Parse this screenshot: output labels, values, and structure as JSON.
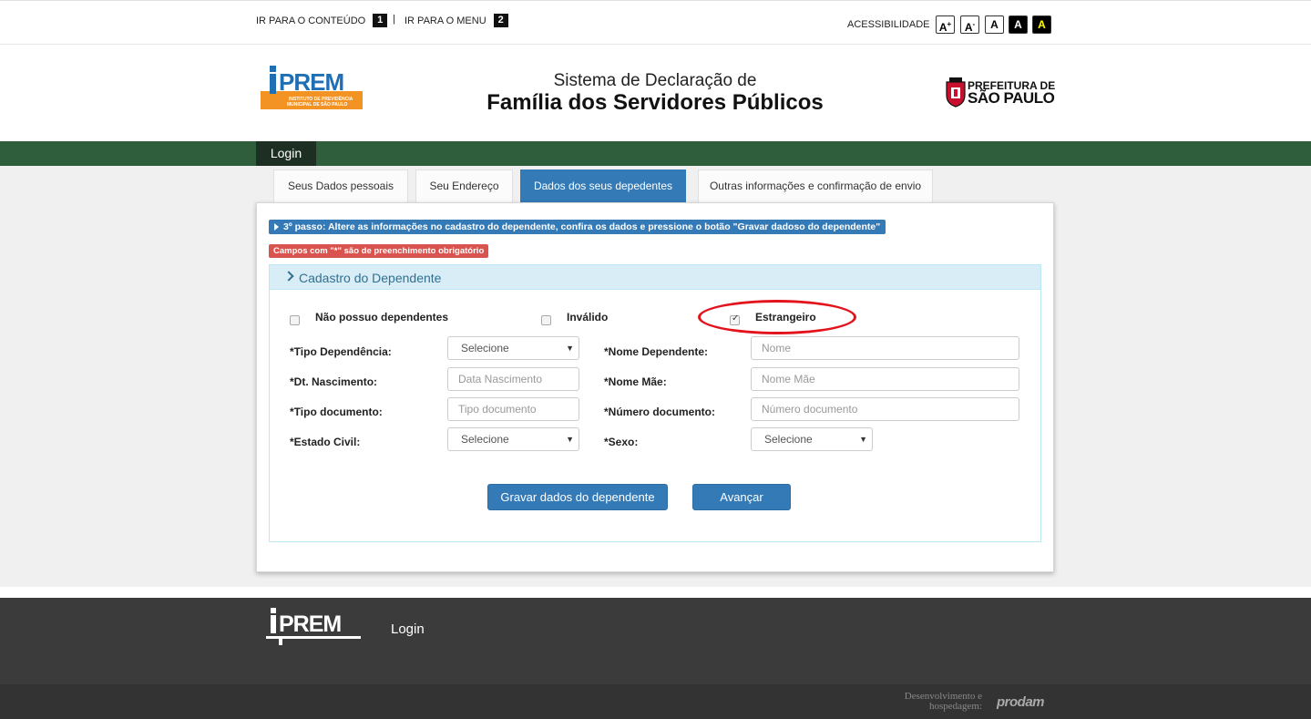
{
  "accessibility_bar": {
    "skip_content_label": "IR PARA O CONTEÚDO",
    "skip_content_key": "1",
    "separator": "|",
    "skip_menu_label": "IR PARA O MENU",
    "skip_menu_key": "2",
    "accessibility_label": "ACESSIBILIDADE",
    "buttons": [
      "A+",
      "A-",
      "A",
      "A",
      "A"
    ]
  },
  "header": {
    "title_line1": "Sistema de Declaração de",
    "title_line2": "Família dos Servidores Públicos",
    "logo_iprem_text": "iPREM",
    "logo_iprem_subtext": "INSTITUTO DE PREVIDÊNCIA MUNICIPAL DE SÃO PAULO",
    "logo_sp_line1": "PREFEITURA DE",
    "logo_sp_line2": "SÃO PAULO"
  },
  "nav": {
    "login_label": "Login"
  },
  "tabs": [
    {
      "label": "Seus Dados pessoais",
      "active": false
    },
    {
      "label": "Seu Endereço",
      "active": false
    },
    {
      "label": "Dados dos seus depedentes",
      "active": true
    },
    {
      "label": "Outras informações e confirmação de envio",
      "active": false
    }
  ],
  "form": {
    "step_message": "3º passo: Altere as informações no cadastro do dependente, confira os dados e pressione o botão \"Gravar dadoso do dependente\"",
    "required_message": "Campos com \"*\" são de preenchimento obrigatório",
    "section_title": "Cadastro do Dependente",
    "checkboxes": [
      {
        "label": "Não possuo dependentes",
        "checked": false
      },
      {
        "label": "Inválido",
        "checked": false
      },
      {
        "label": "Estrangeiro",
        "checked": true
      }
    ],
    "fields": {
      "tipo_dependencia": {
        "label": "*Tipo Dependência:",
        "value": "Selecione"
      },
      "nome_dependente": {
        "label": "*Nome Dependente:",
        "placeholder": "Nome"
      },
      "dt_nascimento": {
        "label": "*Dt. Nascimento:",
        "placeholder": "Data Nascimento"
      },
      "nome_mae": {
        "label": "*Nome Mãe:",
        "placeholder": "Nome Mãe"
      },
      "tipo_documento": {
        "label": "*Tipo documento:",
        "placeholder": "Tipo documento"
      },
      "numero_documento": {
        "label": "*Número documento:",
        "placeholder": "Número documento"
      },
      "estado_civil": {
        "label": "*Estado Civil:",
        "value": "Selecione"
      },
      "sexo": {
        "label": "*Sexo:",
        "value": "Selecione"
      }
    },
    "save_button": "Gravar dados do dependente",
    "next_button": "Avançar"
  },
  "footer": {
    "logo_text": "iPREM",
    "login_label": "Login",
    "dev_text_line1": "Desenvolvimento e",
    "dev_text_line2": "hospedagem:",
    "prodam_text": "prodam"
  },
  "colors": {
    "green_nav": "#2f5e3c",
    "primary_blue": "#337ab7",
    "danger_red": "#d9534f",
    "iprem_orange": "#f39324",
    "iprem_blue": "#1f6fb5",
    "annotation_red": "#e3121b"
  }
}
